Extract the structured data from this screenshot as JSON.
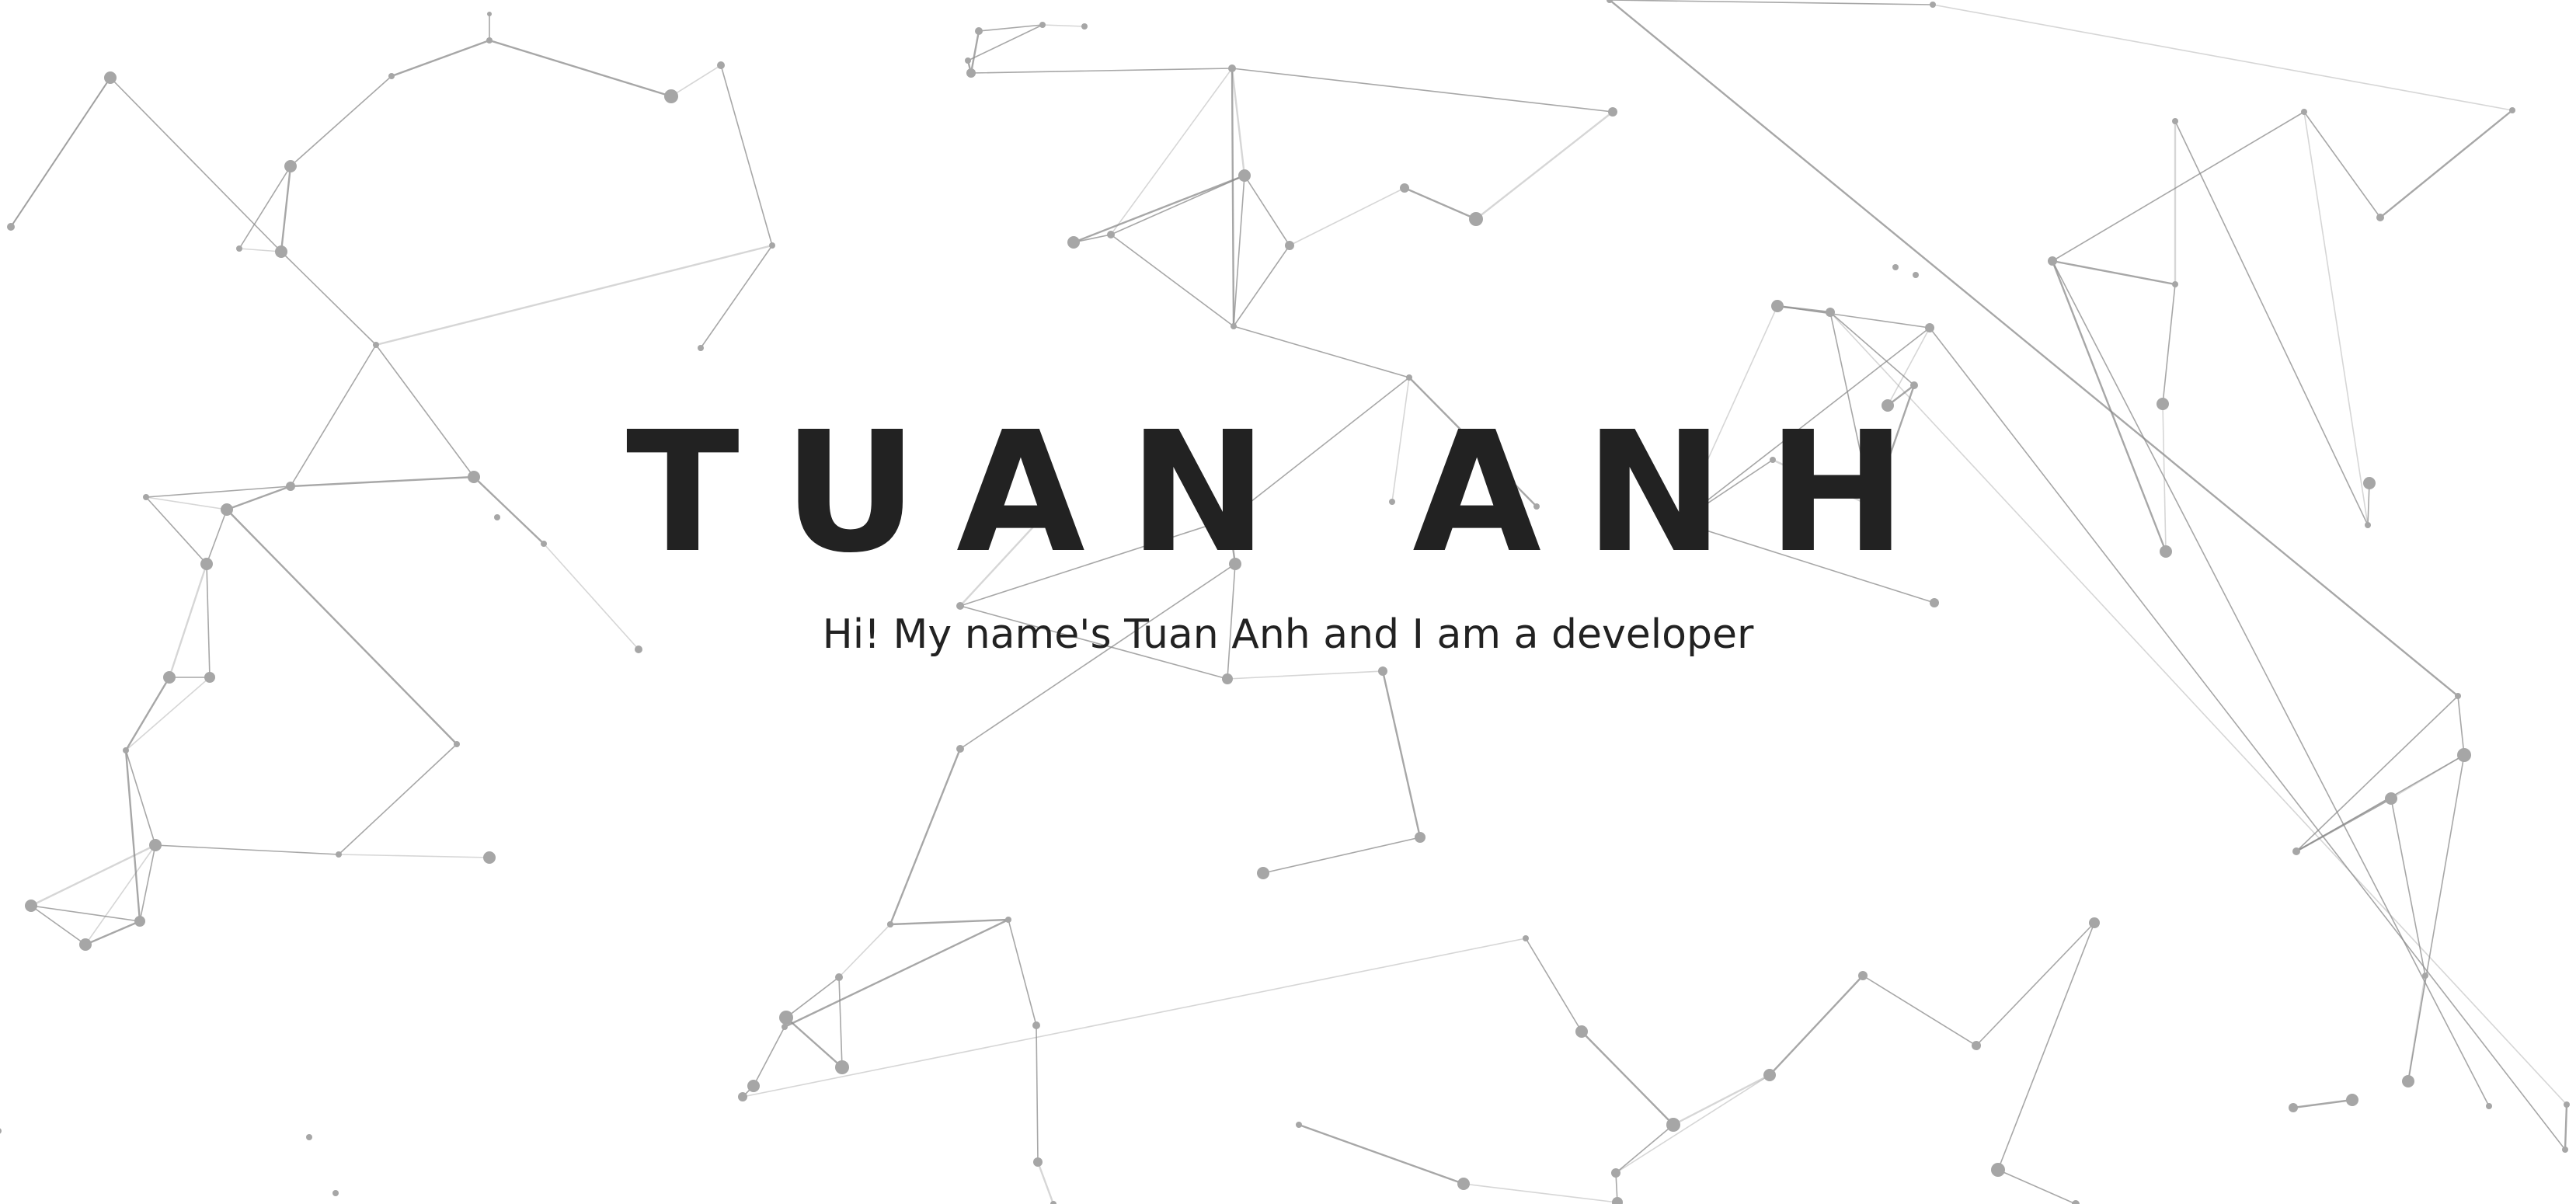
{
  "hero": {
    "title": "TUAN ANH",
    "tagline": "Hi! My name's Tuan Anh and I am a developer"
  },
  "background": {
    "effect": "particle-network",
    "node_color": "#a6a6a6",
    "line_color": "#8a8a8a",
    "page_color": "#ffffff"
  },
  "text_color": "#222222"
}
